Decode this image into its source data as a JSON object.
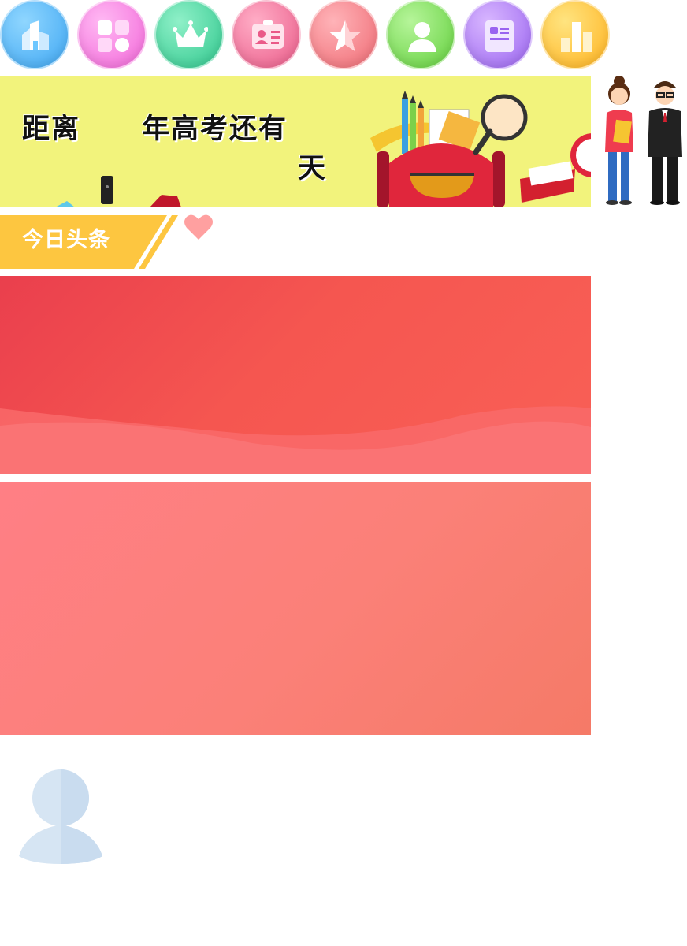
{
  "nav_icons": [
    {
      "icon": "building-icon",
      "color_a": "#6ec7ff",
      "color_b": "#3ea6f2"
    },
    {
      "icon": "grid-apps-icon",
      "color_a": "#ff9cef",
      "color_b": "#f266d8"
    },
    {
      "icon": "crown-icon",
      "color_a": "#6fe6b6",
      "color_b": "#2fc78d"
    },
    {
      "icon": "id-card-icon",
      "color_a": "#ff8fb0",
      "color_b": "#ea5a88"
    },
    {
      "icon": "star-icon",
      "color_a": "#ff9aa0",
      "color_b": "#ef6a73"
    },
    {
      "icon": "person-icon",
      "color_a": "#9ef07a",
      "color_b": "#62cf3c"
    },
    {
      "icon": "news-icon",
      "color_a": "#c79bff",
      "color_b": "#9a64f0"
    },
    {
      "icon": "ranking-icon",
      "color_a": "#ffd850",
      "color_b": "#ffb21e"
    }
  ],
  "banner": {
    "text_prefix": "距离",
    "text_middle": "年高考还有",
    "text_suffix": "天",
    "bg_color": "#f2f37c"
  },
  "headline": {
    "label": "今日头条",
    "tab_color": "#fdc640"
  },
  "colors": {
    "card1": "#f55650",
    "card2": "#fb8078",
    "avatar": "#cfe0f0"
  }
}
